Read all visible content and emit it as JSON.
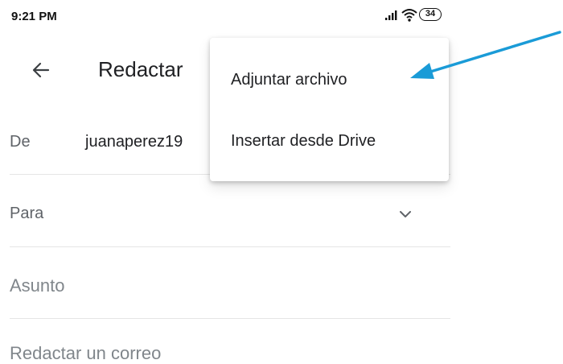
{
  "status_bar": {
    "time": "9:21 PM",
    "battery": "34",
    "icons": [
      "signal-icon",
      "wifi-icon",
      "battery-icon"
    ]
  },
  "toolbar": {
    "back_icon": "arrow-left-icon",
    "title": "Redactar"
  },
  "fields": {
    "from_label": "De",
    "from_value": "juanaperez19",
    "to_label": "Para",
    "to_chevron_icon": "chevron-down-icon",
    "subject_placeholder": "Asunto",
    "body_placeholder": "Redactar un correo"
  },
  "menu": {
    "items": [
      {
        "label": "Adjuntar archivo"
      },
      {
        "label": "Insertar desde Drive"
      }
    ]
  },
  "annotation": {
    "icon": "arrow-icon",
    "color": "#1a9bd7"
  },
  "colors": {
    "text_primary": "#202124",
    "text_secondary": "#5f6368",
    "placeholder": "#80868b",
    "divider": "#e5e5e5"
  }
}
